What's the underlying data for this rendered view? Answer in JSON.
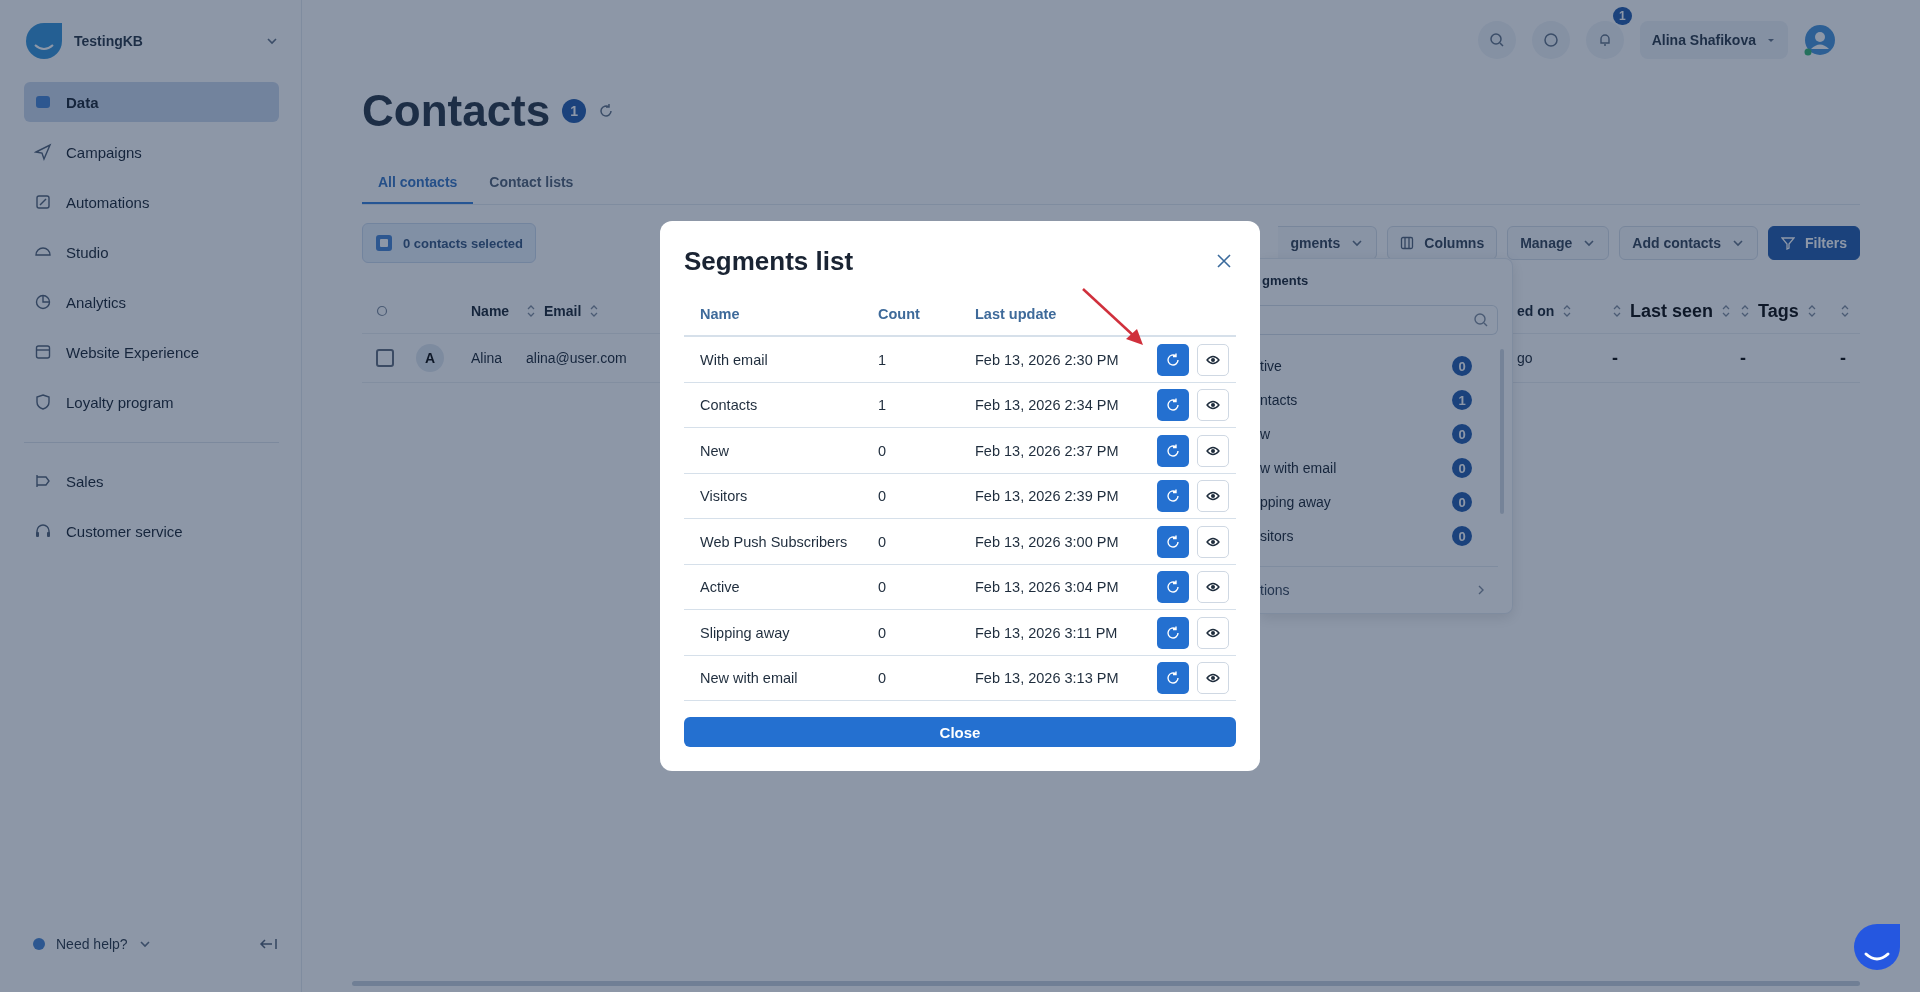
{
  "sidebar": {
    "workspace": "TestingKB",
    "items": [
      {
        "label": "Data",
        "selected": true
      },
      {
        "label": "Campaigns",
        "selected": false
      },
      {
        "label": "Automations",
        "selected": false
      },
      {
        "label": "Studio",
        "selected": false
      },
      {
        "label": "Analytics",
        "selected": false
      },
      {
        "label": "Website Experience",
        "selected": false
      },
      {
        "label": "Loyalty program",
        "selected": false
      }
    ],
    "items_secondary": [
      {
        "label": "Sales",
        "selected": false
      },
      {
        "label": "Customer service",
        "selected": false
      }
    ],
    "help": "Need help?"
  },
  "header": {
    "notifications_badge": "1",
    "user_name": "Alina Shafikova"
  },
  "page": {
    "title": "Contacts",
    "count_badge": "1"
  },
  "tabs": [
    {
      "label": "All contacts",
      "selected": true
    },
    {
      "label": "Contact lists",
      "selected": false
    }
  ],
  "toolbar": {
    "selection": "0 contacts selected",
    "buttons": [
      {
        "label": "gments",
        "kind": "dropdown"
      },
      {
        "label": "Columns",
        "kind": "columns"
      },
      {
        "label": "Manage",
        "kind": "dropdown"
      },
      {
        "label": "Add contacts",
        "kind": "dropdown"
      },
      {
        "label": "Filters",
        "kind": "primary"
      }
    ]
  },
  "table": {
    "columns": [
      {
        "label": "Name",
        "sortable": false,
        "handle": true
      },
      {
        "label": "Email",
        "sortable": true,
        "handle": true
      },
      {
        "label": "ed on",
        "sortable": true,
        "handle": false
      },
      {
        "label": "Last seen",
        "sortable": true,
        "handle": true
      },
      {
        "label": "Tags",
        "sortable": true,
        "handle": true
      }
    ],
    "rows": [
      {
        "checked": false,
        "avatar": "A",
        "name": "Alina",
        "email": "alina@user.com",
        "created": "go",
        "last_seen": "-",
        "tags": "-",
        "column_6": "-"
      }
    ]
  },
  "segments_menu": {
    "title": "gments",
    "items": [
      {
        "label": "tive",
        "count": "0"
      },
      {
        "label": "ntacts",
        "count": "1"
      },
      {
        "label": "w",
        "count": "0"
      },
      {
        "label": "w with email",
        "count": "0"
      },
      {
        "label": "pping away",
        "count": "0"
      },
      {
        "label": "sitors",
        "count": "0"
      }
    ],
    "footer": "tions"
  },
  "modal": {
    "title": "Segments list",
    "columns": [
      "Name",
      "Count",
      "Last update"
    ],
    "rows": [
      {
        "name": "With email",
        "count": "1",
        "updated": "Feb 13, 2026 2:30 PM"
      },
      {
        "name": "Contacts",
        "count": "1",
        "updated": "Feb 13, 2026 2:34 PM"
      },
      {
        "name": "New",
        "count": "0",
        "updated": "Feb 13, 2026 2:37 PM"
      },
      {
        "name": "Visitors",
        "count": "0",
        "updated": "Feb 13, 2026 2:39 PM"
      },
      {
        "name": "Web Push Subscribers",
        "count": "0",
        "updated": "Feb 13, 2026 3:00 PM"
      },
      {
        "name": "Active",
        "count": "0",
        "updated": "Feb 13, 2026 3:04 PM"
      },
      {
        "name": "Slipping away",
        "count": "0",
        "updated": "Feb 13, 2026 3:11 PM"
      },
      {
        "name": "New with email",
        "count": "0",
        "updated": "Feb 13, 2026 3:13 PM"
      }
    ],
    "close_button": "Close"
  }
}
